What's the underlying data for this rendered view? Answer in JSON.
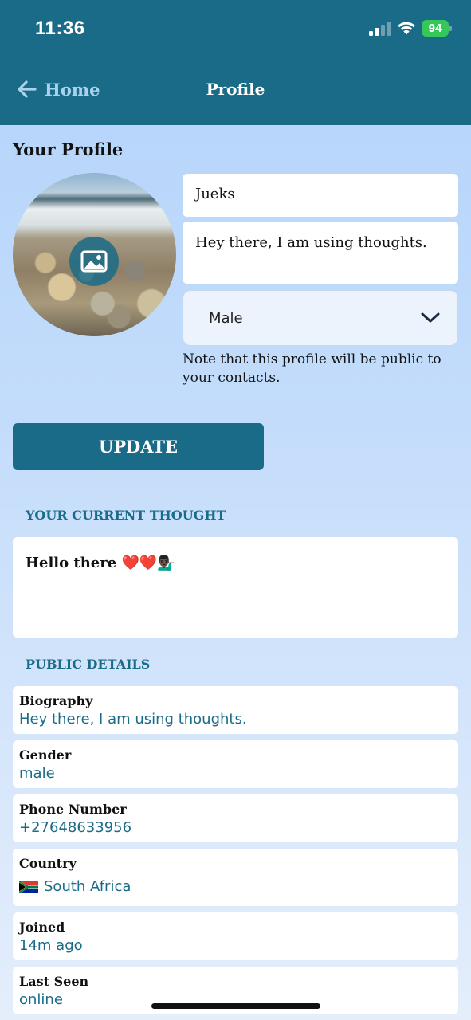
{
  "status_bar": {
    "time": "11:36",
    "battery": "94"
  },
  "nav": {
    "back_label": "Home",
    "title": "Profile"
  },
  "profile": {
    "section_title": "Your Profile",
    "name": "Jueks",
    "bio": "Hey there, I am using thoughts.",
    "gender_selected": "Male",
    "note": "Note that this profile will be public to your contacts.",
    "update_label": "UPDATE"
  },
  "thought": {
    "section_label": "YOUR CURRENT THOUGHT",
    "text": "Hello there ❤️❤️💁🏿‍♂️"
  },
  "public_details": {
    "section_label": "PUBLIC DETAILS",
    "items": [
      {
        "label": "Biography",
        "value": "Hey there, I am using thoughts."
      },
      {
        "label": "Gender",
        "value": "male"
      },
      {
        "label": "Phone Number",
        "value": "+27648633956"
      },
      {
        "label": "Country",
        "value": "South Africa"
      },
      {
        "label": "Joined",
        "value": "14m ago"
      },
      {
        "label": "Last Seen",
        "value": "online"
      }
    ]
  },
  "colors": {
    "header": "#1a6b87",
    "accent": "#1a6b87",
    "back_label": "#a9d2ec",
    "battery": "#35c759"
  },
  "icons": [
    "signal-icon",
    "wifi-icon",
    "battery-icon",
    "back-arrow-icon",
    "image-icon",
    "chevron-down-icon",
    "south-africa-flag-icon"
  ]
}
